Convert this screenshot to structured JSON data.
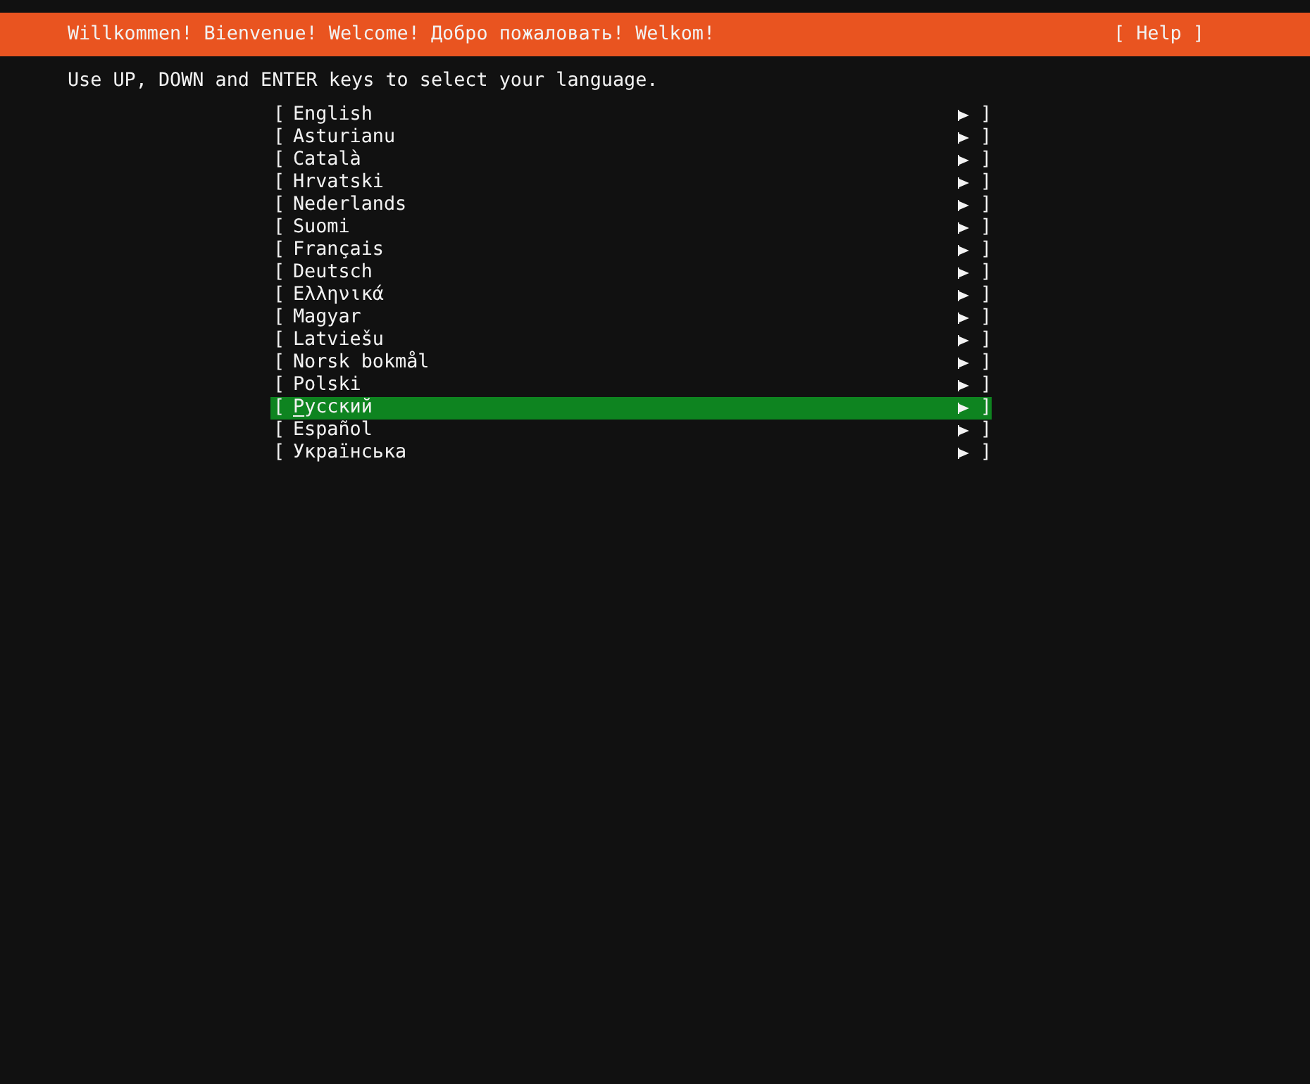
{
  "header": {
    "title": "Willkommen! Bienvenue! Welcome! Добро пожаловать! Welkom!",
    "help": "[ Help ]"
  },
  "instruction": "Use UP, DOWN and ENTER keys to select your language.",
  "languages": [
    {
      "open": "[",
      "label": "English",
      "close": "]",
      "selected": false
    },
    {
      "open": "[",
      "label": "Asturianu",
      "close": "]",
      "selected": false
    },
    {
      "open": "[",
      "label": "Català",
      "close": "]",
      "selected": false
    },
    {
      "open": "[",
      "label": "Hrvatski",
      "close": "]",
      "selected": false
    },
    {
      "open": "[",
      "label": "Nederlands",
      "close": "]",
      "selected": false
    },
    {
      "open": "[",
      "label": "Suomi",
      "close": "]",
      "selected": false
    },
    {
      "open": "[",
      "label": "Français",
      "close": "]",
      "selected": false
    },
    {
      "open": "[",
      "label": "Deutsch",
      "close": "]",
      "selected": false
    },
    {
      "open": "[",
      "label": "Ελληνικά",
      "close": "]",
      "selected": false
    },
    {
      "open": "[",
      "label": "Magyar",
      "close": "]",
      "selected": false
    },
    {
      "open": "[",
      "label": "Latviešu",
      "close": "]",
      "selected": false
    },
    {
      "open": "[",
      "label": "Norsk bokmål",
      "close": "]",
      "selected": false
    },
    {
      "open": "[",
      "label": "Polski",
      "close": "]",
      "selected": false
    },
    {
      "open": "[",
      "label": "Русский",
      "close": "]",
      "selected": true
    },
    {
      "open": "[",
      "label": "Español",
      "close": "]",
      "selected": false
    },
    {
      "open": "[",
      "label": "Українська",
      "close": "]",
      "selected": false
    }
  ]
}
